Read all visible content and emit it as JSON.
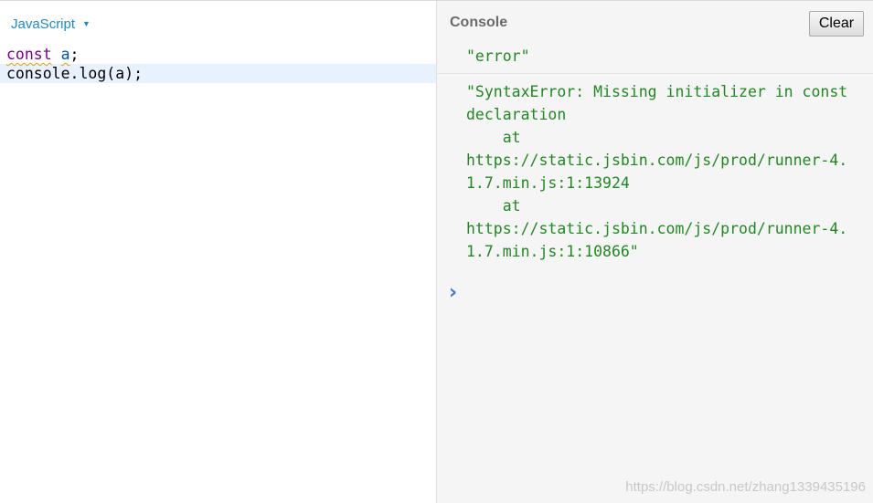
{
  "editor": {
    "language_label": "JavaScript",
    "dropdown_icon": "caret-down-icon",
    "code_lines": {
      "line1": {
        "keyword": "const",
        "rest1": " ",
        "identifier": "a",
        "rest2": ";"
      },
      "line2": {
        "text": "console.log(a);"
      }
    }
  },
  "console": {
    "title": "Console",
    "clear_label": "Clear",
    "entries": [
      "\"error\"",
      "\"SyntaxError: Missing initializer in const declaration\n    at\nhttps://static.jsbin.com/js/prod/runner-4.1.7.min.js:1:13924\n    at\nhttps://static.jsbin.com/js/prod/runner-4.1.7.min.js:1:10866\""
    ],
    "prompt_glyph": "›",
    "prompt_icon": "chevron-right-icon"
  },
  "watermark": "https://blog.csdn.net/zhang1339435196",
  "colors": {
    "language_link": "#1a8ad6",
    "keyword": "#770088",
    "console_text": "#1e8a1e",
    "prompt": "#3a78d8",
    "active_line": "#e8f2ff",
    "console_bg": "#f5f5f5"
  }
}
